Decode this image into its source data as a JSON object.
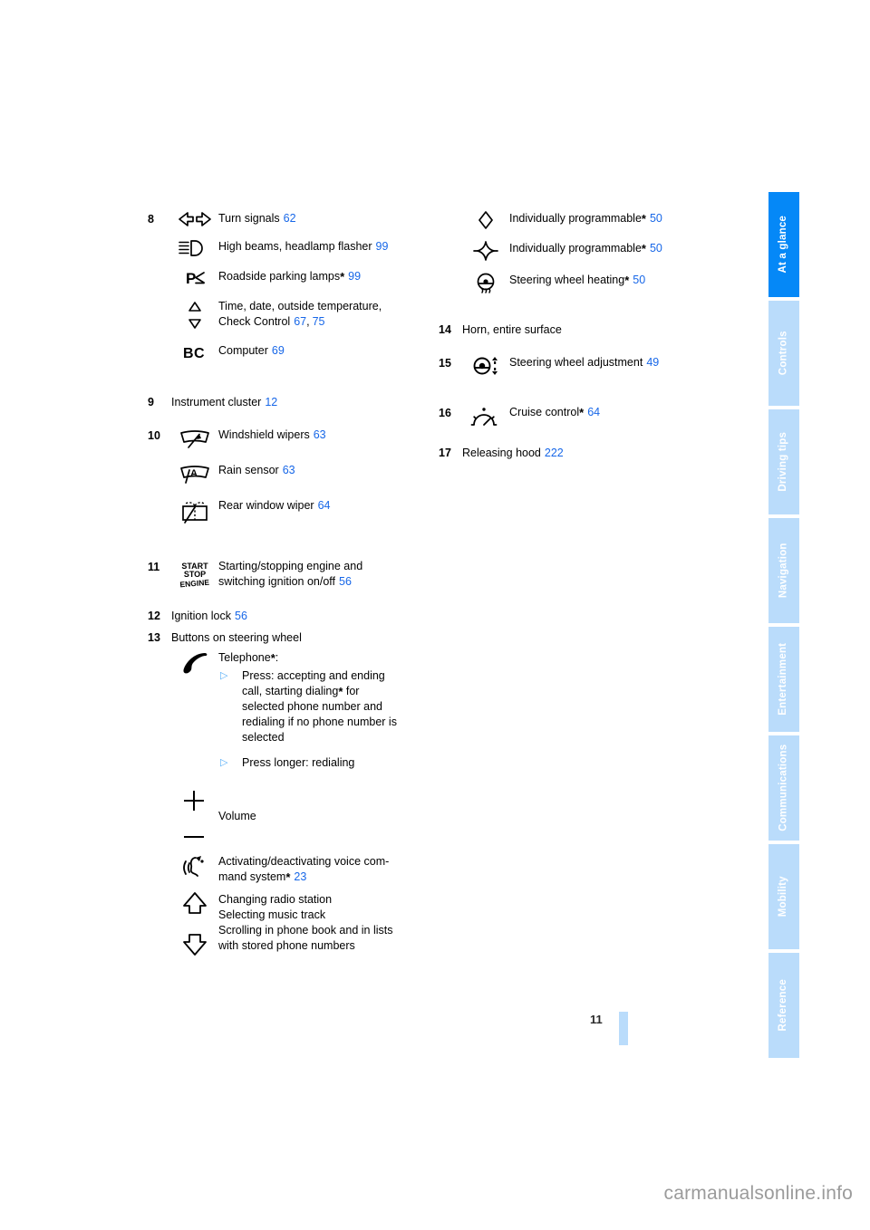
{
  "document": {
    "page_number": "11",
    "watermark": "carmanualsonline.info"
  },
  "tab_rail": {
    "tabs": [
      {
        "label": "At a glance",
        "active": true
      },
      {
        "label": "Controls",
        "active": false
      },
      {
        "label": "Driving tips",
        "active": false
      },
      {
        "label": "Navigation",
        "active": false
      },
      {
        "label": "Entertainment",
        "active": false
      },
      {
        "label": "Communications",
        "active": false
      },
      {
        "label": "Mobility",
        "active": false
      },
      {
        "label": "Reference",
        "active": false
      }
    ],
    "active_color": "#0588f7",
    "inactive_color": "#badcfb"
  },
  "colors": {
    "page_reference": "#1767e8",
    "bullet": "#57aef7"
  },
  "left_column": {
    "item8": {
      "number": "8",
      "entries": [
        {
          "icon": "turn-signals-icon",
          "label": "Turn signals",
          "ref": "62"
        },
        {
          "icon": "high-beams-icon",
          "label": "High beams, headlamp flasher",
          "ref": "99"
        },
        {
          "icon": "roadside-parking-lamps-icon",
          "label": "Roadside parking lamps",
          "star": "*",
          "ref": "99"
        },
        {
          "icon": "up-down-arrows-icon",
          "label_line1": "Time, date, outside temperature,",
          "label_line2": "Check Control",
          "ref": "67",
          "ref2": "75",
          "separator": ","
        },
        {
          "icon": "bc-computer-icon",
          "label": "Computer",
          "ref": "69"
        }
      ]
    },
    "item9": {
      "number": "9",
      "label": "Instrument cluster",
      "ref": "12"
    },
    "item10": {
      "number": "10",
      "entries": [
        {
          "icon": "windshield-wipers-icon",
          "label": "Windshield wipers",
          "ref": "63"
        },
        {
          "icon": "rain-sensor-icon",
          "label": "Rain sensor",
          "ref": "63"
        },
        {
          "icon": "rear-window-wiper-icon",
          "label": "Rear window wiper",
          "ref": "64"
        }
      ]
    },
    "item11": {
      "number": "11",
      "icon": "start-stop-engine-icon",
      "label_line1": "Starting/stopping engine and",
      "label_line2": "switching ignition on/off",
      "ref": "56"
    },
    "item12": {
      "number": "12",
      "label": "Ignition lock",
      "ref": "56"
    },
    "item13": {
      "number": "13",
      "label": "Buttons on steering wheel",
      "telephone": {
        "icon": "telephone-handset-icon",
        "label": "Telephone",
        "star": "*",
        "colon": ":",
        "bullets": [
          "Press: accepting and ending call, starting dialing* for selected phone number and redialing if no phone number is selected",
          "Press longer: redialing"
        ],
        "bullet1_lines": [
          "Press: accepting and ending",
          "call, starting dialing",
          "selected phone number and",
          "redialing if no phone number is",
          "selected"
        ],
        "bullet1_star": "*",
        "bullet1_tail": " for",
        "bullet2": "Press longer: redialing"
      },
      "volume": {
        "icon": "plus-minus-icon",
        "label": "Volume"
      },
      "voice": {
        "icon": "voice-command-icon",
        "label_line1": "Activating/deactivating voice com-",
        "label_line2": "mand system",
        "star": "*",
        "ref": "23"
      },
      "updown": {
        "icon_up": "arrow-up-icon",
        "icon_down": "arrow-down-icon",
        "lines": [
          "Changing radio station",
          "Selecting music track",
          "Scrolling in phone book and in lists",
          "with stored phone numbers"
        ]
      }
    }
  },
  "right_column": {
    "programmable": [
      {
        "icon": "diamond-icon",
        "label": "Individually programmable",
        "star": "*",
        "ref": "50"
      },
      {
        "icon": "four-point-star-icon",
        "label": "Individually programmable",
        "star": "*",
        "ref": "50"
      },
      {
        "icon": "steering-wheel-heating-icon",
        "label": "Steering wheel heating",
        "star": "*",
        "ref": "50"
      }
    ],
    "item14": {
      "number": "14",
      "label": "Horn, entire surface"
    },
    "item15": {
      "number": "15",
      "icon": "steering-wheel-adjustment-icon",
      "label": "Steering wheel adjustment",
      "ref": "49"
    },
    "item16": {
      "number": "16",
      "icon": "cruise-control-icon",
      "label": "Cruise control",
      "star": "*",
      "ref": "64"
    },
    "item17": {
      "number": "17",
      "label": "Releasing hood",
      "ref": "222"
    }
  }
}
